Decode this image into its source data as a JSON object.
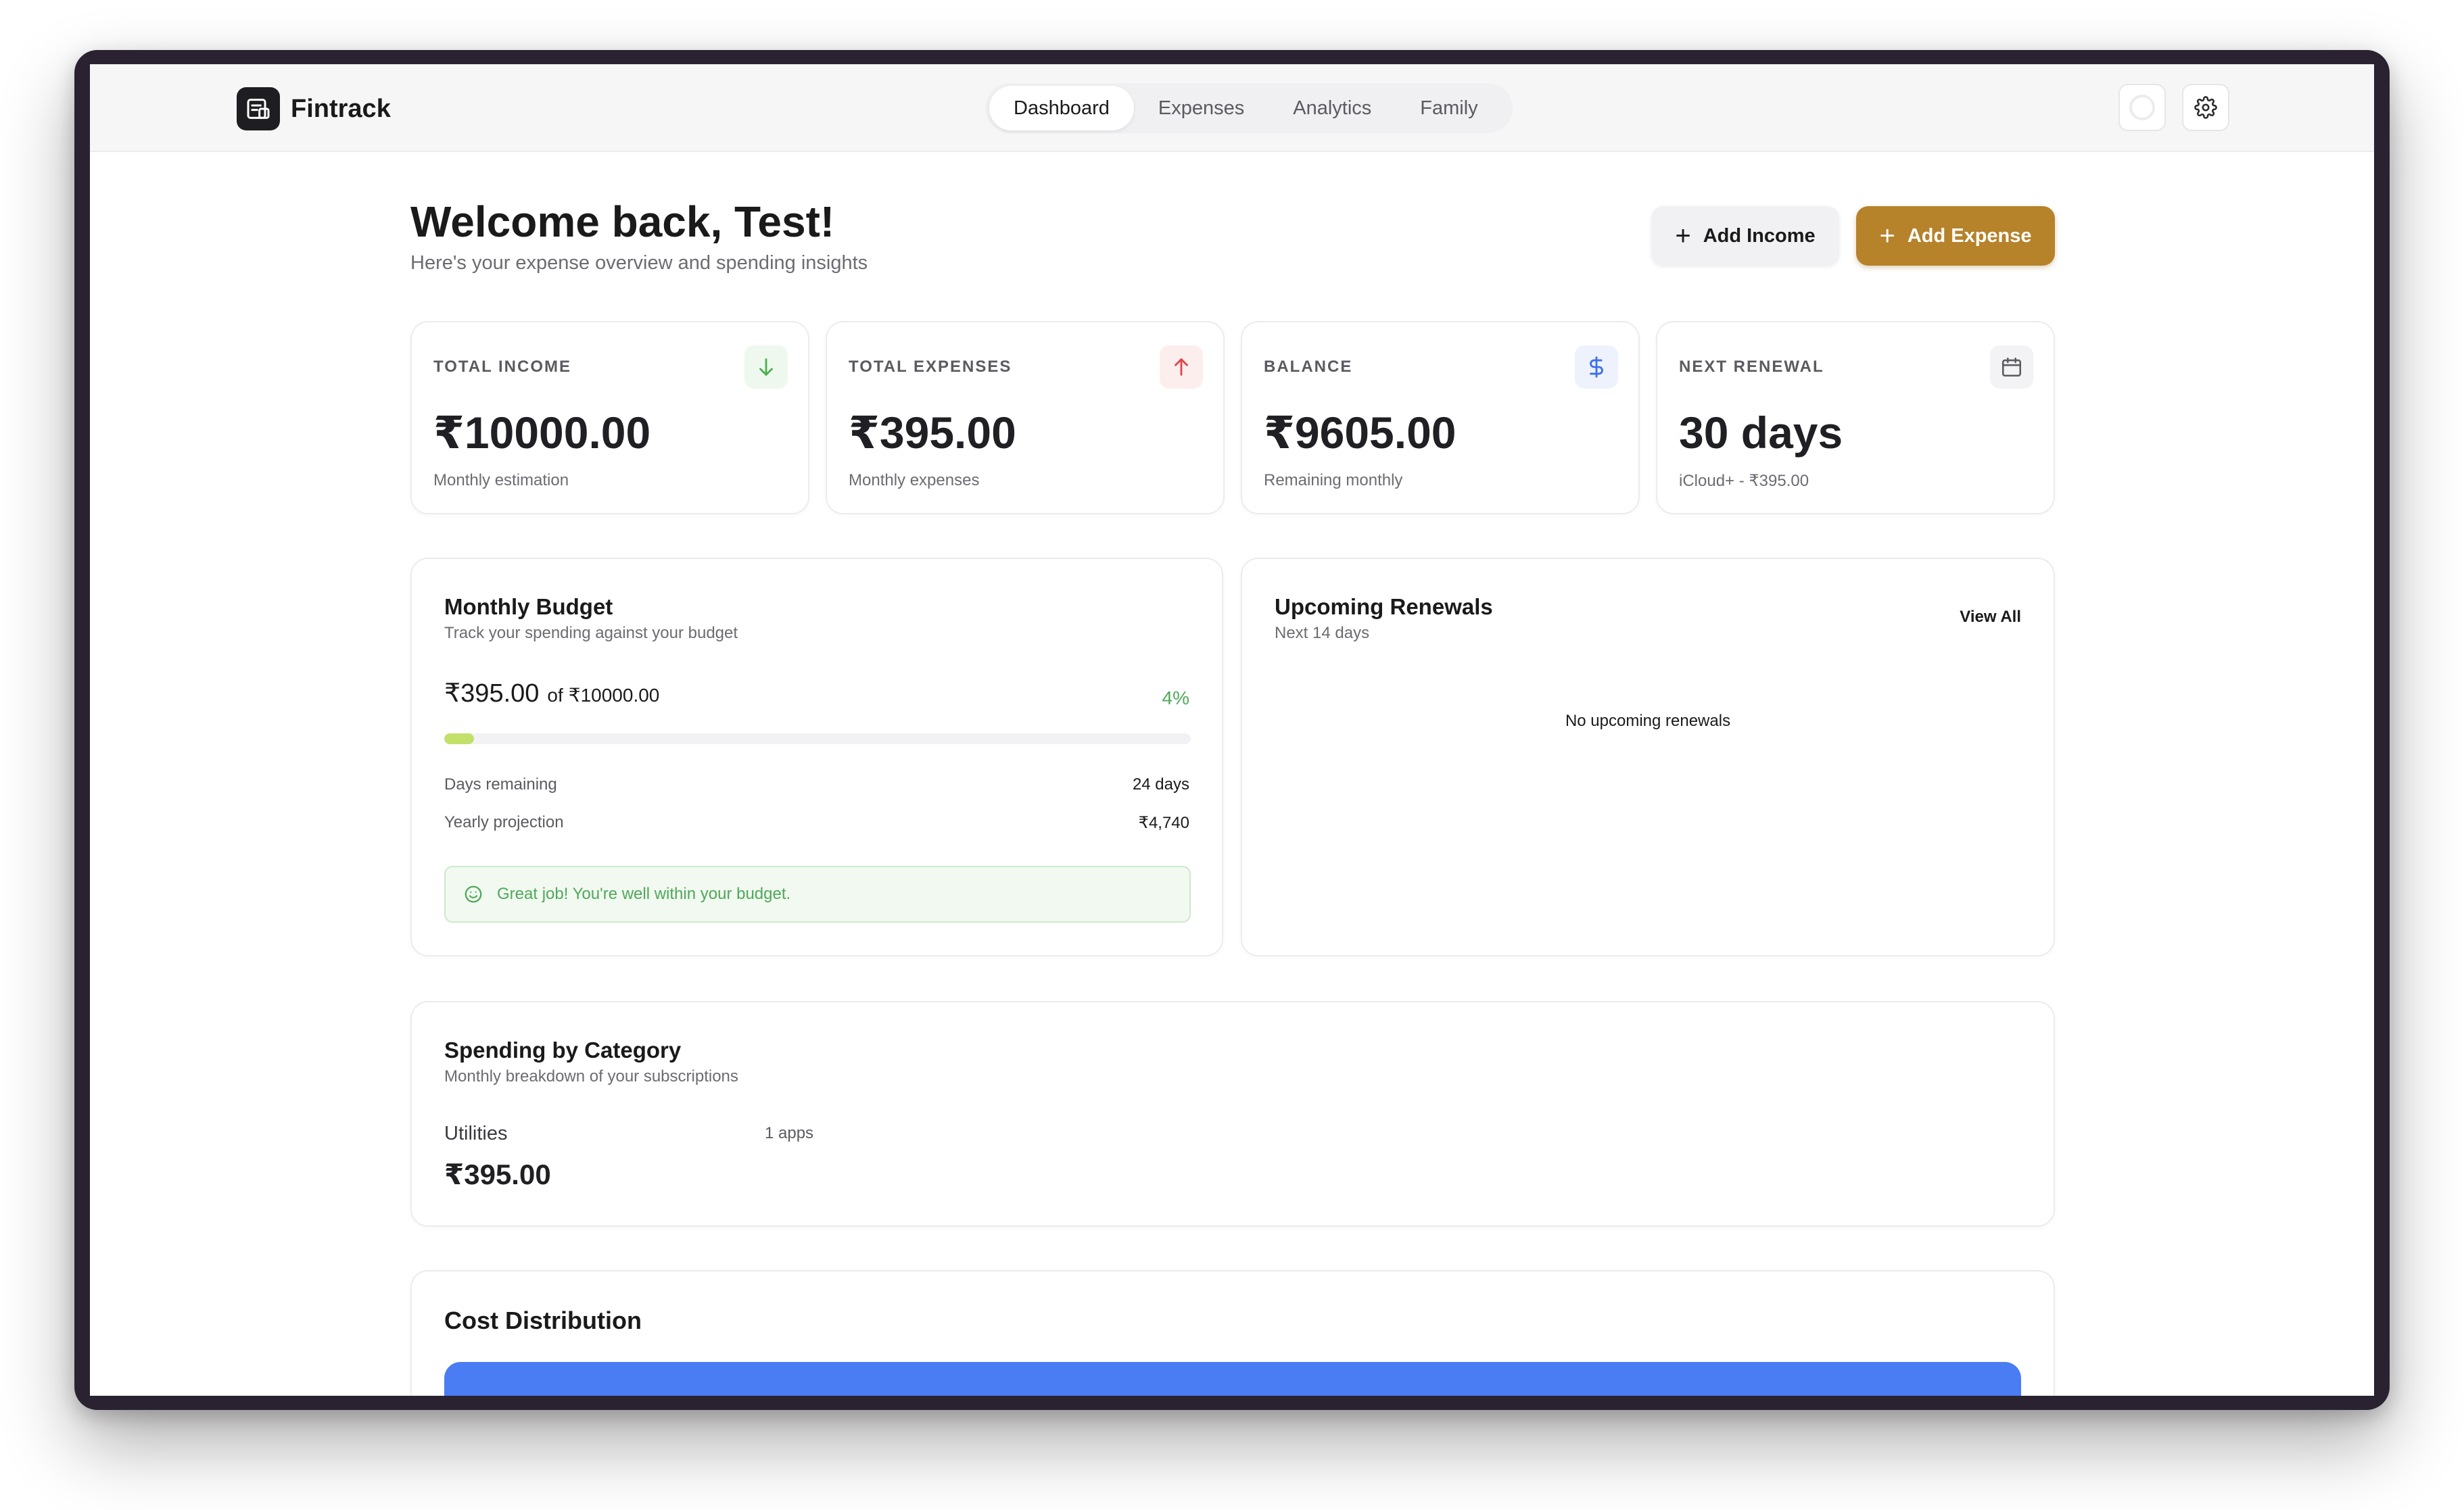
{
  "app": {
    "name": "Fintrack"
  },
  "nav": {
    "tabs": [
      "Dashboard",
      "Expenses",
      "Analytics",
      "Family"
    ],
    "active": "Dashboard"
  },
  "header": {
    "title": "Welcome back, Test!",
    "subtitle": "Here's your expense overview and spending insights",
    "add_income_label": "Add Income",
    "add_expense_label": "Add Expense"
  },
  "stats": [
    {
      "label": "TOTAL INCOME",
      "value": "₹10000.00",
      "sub": "Monthly estimation",
      "icon": "arrow-down-icon",
      "color": "#4caf50"
    },
    {
      "label": "TOTAL EXPENSES",
      "value": "₹395.00",
      "sub": "Monthly expenses",
      "icon": "arrow-up-icon",
      "color": "#e0454a"
    },
    {
      "label": "BALANCE",
      "value": "₹9605.00",
      "sub": "Remaining monthly",
      "icon": "dollar-icon",
      "color": "#3b6ff0"
    },
    {
      "label": "NEXT RENEWAL",
      "value": "30 days",
      "sub": "iCloud+ - ₹395.00",
      "icon": "calendar-icon",
      "color": "#5a5a60"
    }
  ],
  "budget": {
    "title": "Monthly Budget",
    "subtitle": "Track your spending against your budget",
    "spent": "₹395.00",
    "of_label": "of",
    "total": "₹10000.00",
    "percent_label": "4%",
    "percent": 4,
    "days_remaining_label": "Days remaining",
    "days_remaining_value": "24 days",
    "yearly_projection_label": "Yearly projection",
    "yearly_projection_value": "₹4,740",
    "message": "Great job! You're well within your budget."
  },
  "renewals": {
    "title": "Upcoming Renewals",
    "subtitle": "Next 14 days",
    "view_all_label": "View All",
    "empty_message": "No upcoming renewals"
  },
  "category": {
    "title": "Spending by Category",
    "subtitle": "Monthly breakdown of your subscriptions",
    "items": [
      {
        "name": "Utilities",
        "count": "1 apps",
        "amount": "₹395.00"
      }
    ]
  },
  "distribution": {
    "title": "Cost Distribution",
    "bar_color": "#4a7cf3"
  },
  "colors": {
    "accent": "#b6822a",
    "success": "#4fa85a",
    "progress": "#c3e06a"
  }
}
